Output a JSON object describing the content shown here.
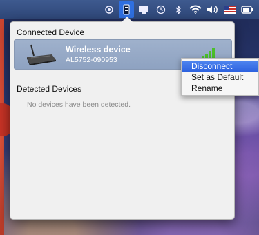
{
  "panel": {
    "connected_heading": "Connected Device",
    "detected_heading": "Detected Devices",
    "empty_message": "No devices have been detected."
  },
  "device": {
    "name": "Wireless device",
    "id": "AL5752-090953",
    "icon": "router-icon",
    "signal_icon": "signal-bars-icon"
  },
  "context_menu": {
    "items": [
      {
        "label": "Disconnect",
        "highlighted": true
      },
      {
        "label": "Set as Default",
        "highlighted": false
      },
      {
        "label": "Rename",
        "highlighted": false
      }
    ]
  },
  "menubar": {
    "icons": [
      "cloud-sync-icon",
      "device-manager-icon",
      "display-icon",
      "time-machine-icon",
      "bluetooth-icon",
      "wifi-icon",
      "volume-icon",
      "flag-icon",
      "battery-icon"
    ],
    "active_icon": "device-manager-icon"
  },
  "colors": {
    "menubar": "#3e5a8f",
    "highlight": "#2d62df",
    "card": "#95a8c6",
    "signal": "#4bbf2a"
  }
}
